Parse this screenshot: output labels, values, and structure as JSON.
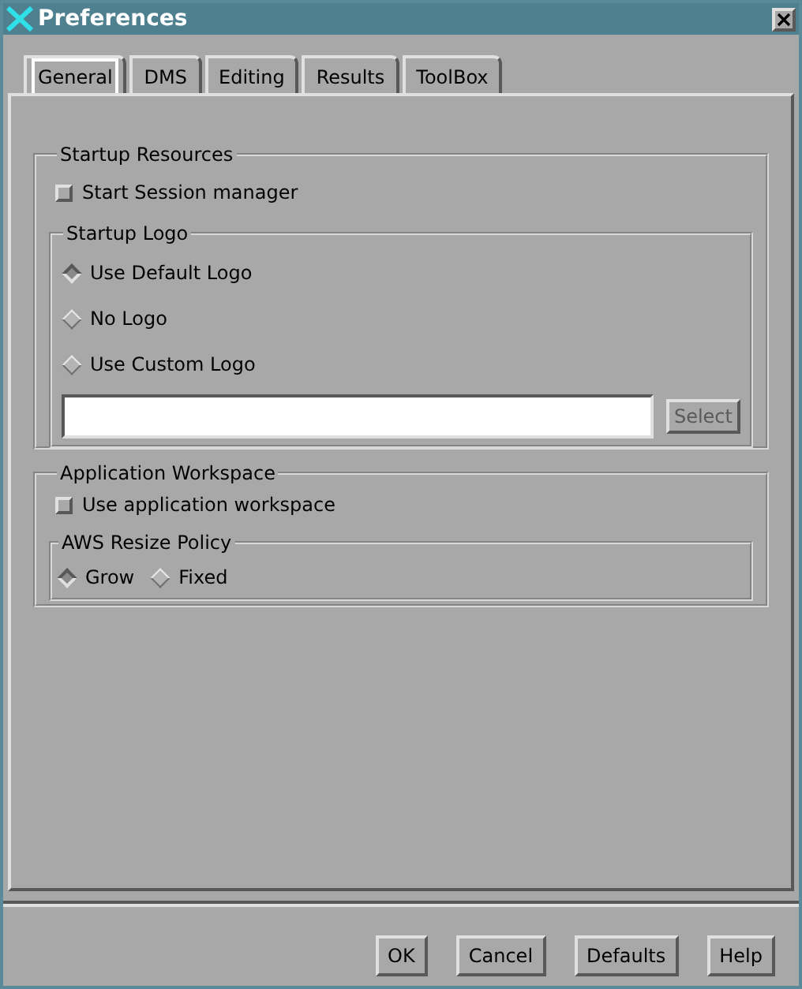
{
  "window": {
    "title": "Preferences"
  },
  "tabs": [
    {
      "label": "General",
      "selected": true
    },
    {
      "label": "DMS",
      "selected": false
    },
    {
      "label": "Editing",
      "selected": false
    },
    {
      "label": "Results",
      "selected": false
    },
    {
      "label": "ToolBox",
      "selected": false
    }
  ],
  "startup_resources": {
    "title": "Startup Resources",
    "checkbox": {
      "label": "Start Session manager",
      "checked": false
    },
    "logo_group": {
      "title": "Startup Logo",
      "options": [
        {
          "label": "Use Default Logo",
          "selected": true
        },
        {
          "label": "No Logo",
          "selected": false
        },
        {
          "label": "Use Custom Logo",
          "selected": false
        }
      ],
      "select_button": {
        "label": "Select",
        "disabled": true
      }
    }
  },
  "application_workspace": {
    "title": "Application Workspace",
    "checkbox": {
      "label": "Use application workspace",
      "checked": false
    },
    "resize_group": {
      "title": "AWS Resize Policy",
      "options": [
        {
          "label": "Grow",
          "selected": true
        },
        {
          "label": "Fixed",
          "selected": false
        }
      ]
    }
  },
  "buttons": [
    "OK",
    "Cancel",
    "Defaults",
    "Help"
  ]
}
